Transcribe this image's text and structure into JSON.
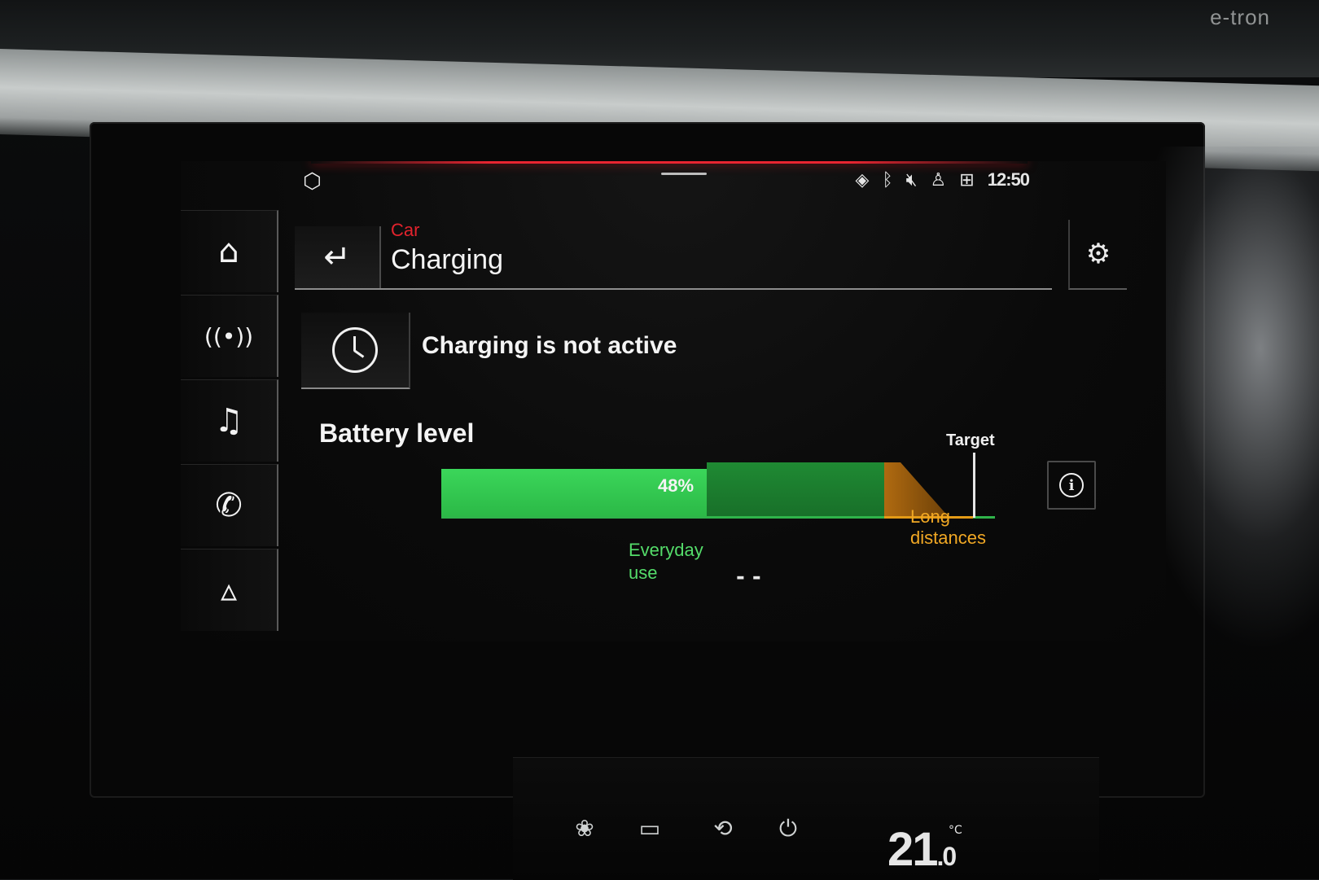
{
  "brand_badge": "e-tron",
  "status_bar": {
    "time": "12:50",
    "icons": [
      "box-icon",
      "navigation-warning-icon",
      "bluetooth-icon",
      "mute-icon",
      "user-icon",
      "signal-icon"
    ]
  },
  "sidebar": {
    "items": [
      {
        "icon": "home-icon",
        "glyph": "⌂"
      },
      {
        "icon": "radio-icon",
        "glyph": "((•))"
      },
      {
        "icon": "music-icon",
        "glyph": "♫"
      },
      {
        "icon": "phone-icon",
        "glyph": "✆"
      },
      {
        "icon": "navigation-icon",
        "glyph": "▵"
      }
    ]
  },
  "header": {
    "breadcrumb": "Car",
    "title": "Charging",
    "back_glyph": "↵",
    "settings_glyph": "⚙"
  },
  "charging": {
    "status_text": "Charging is not active"
  },
  "battery": {
    "label": "Battery level",
    "level_percent": 48,
    "level_text": "48%",
    "target_label": "Target",
    "target_percent": 96,
    "everyday_limit_percent": 80,
    "legend_everyday": "Everyday use",
    "legend_long": "Long distances",
    "range_text": "- -"
  },
  "colors": {
    "accent_red": "#e82531",
    "battery_green": "#3bd65a",
    "everyday_green": "#54dc6a",
    "long_distance_orange": "#f1a824"
  },
  "climate": {
    "temperature": "21",
    "temperature_decimal": ".0",
    "unit": "°C"
  }
}
